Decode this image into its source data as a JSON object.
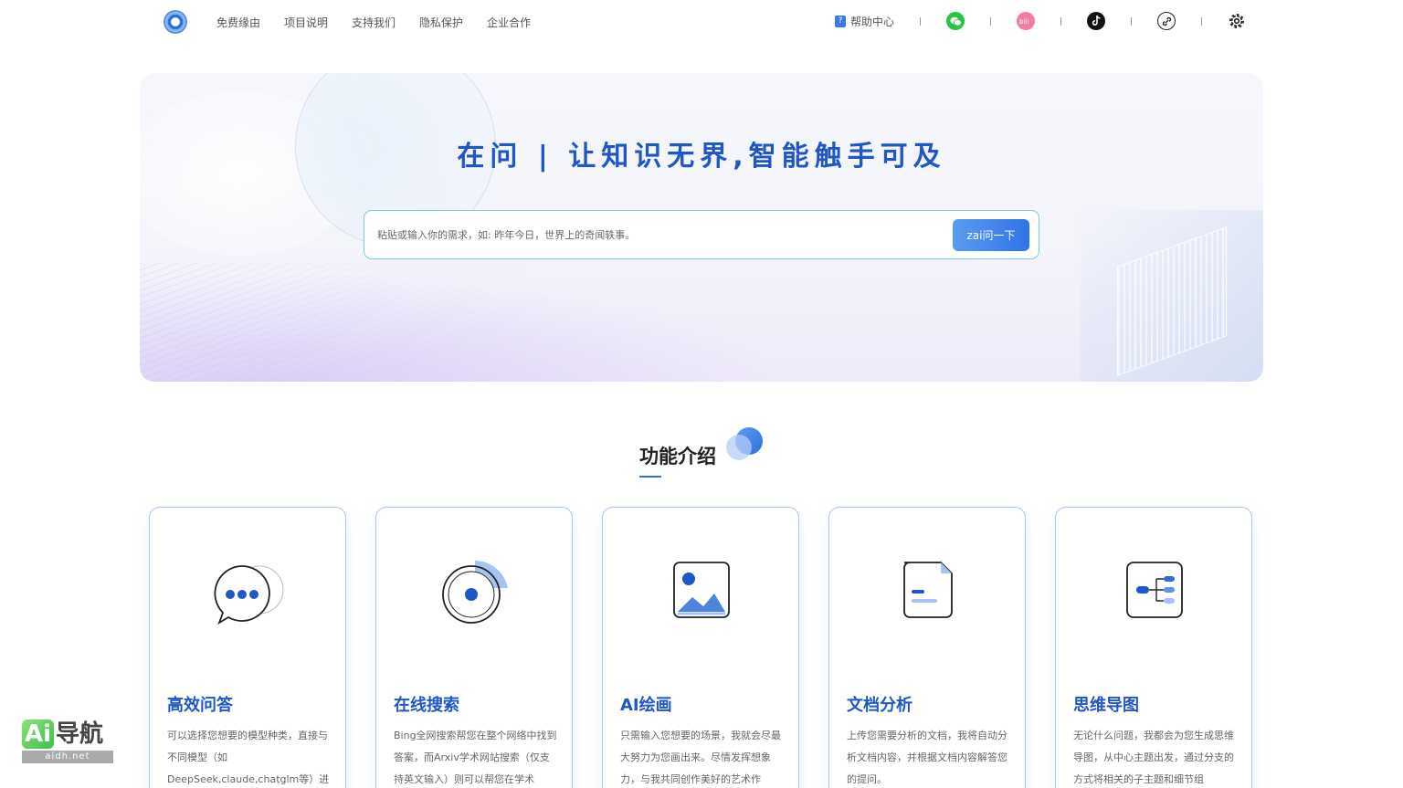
{
  "nav": {
    "links": [
      "免费缘由",
      "项目说明",
      "支持我们",
      "隐私保护",
      "企业合作"
    ],
    "help_label": "帮助中心",
    "icons": [
      "wechat-icon",
      "bilibili-icon",
      "tiktok-icon",
      "link-icon",
      "gear-icon"
    ]
  },
  "hero": {
    "title": "在问 | 让知识无界,智能触手可及",
    "search_placeholder": "粘贴或输入你的需求，如: 昨年今日，世界上的奇闻轶事。",
    "search_button": "zai问一下"
  },
  "features": {
    "title": "功能介绍",
    "cards": [
      {
        "title": "高效问答",
        "desc": "可以选择您想要的模型种类，直接与不同模型（如DeepSeek,claude,chatglm等）进",
        "icon": "chat-bubble-icon"
      },
      {
        "title": "在线搜索",
        "desc": "Bing全网搜索帮您在整个网络中找到答案，而Arxiv学术网站搜索（仅支持英文输入）则可以帮您在学术",
        "icon": "search-target-icon"
      },
      {
        "title": "AI绘画",
        "desc": "只需输入您想要的场景，我就会尽最大努力为您画出来。尽情发挥想象力，与我共同创作美好的艺术作",
        "icon": "image-icon"
      },
      {
        "title": "文档分析",
        "desc": "上传您需要分析的文档，我将自动分析文档内容，并根据文档内容解答您的提问。",
        "icon": "document-icon"
      },
      {
        "title": "思维导图",
        "desc": "无论什么问题，我都会为您生成思维导图，从中心主题出发，通过分支的方式将相关的子主题和细节组",
        "icon": "mindmap-icon"
      }
    ]
  },
  "watermark": {
    "brand_a": "Ai",
    "brand_b": "导航",
    "url": "aidh.net"
  },
  "colors": {
    "primary": "#1f56c8",
    "accent": "#2f74e6",
    "card_border": "#a9c6ea"
  }
}
